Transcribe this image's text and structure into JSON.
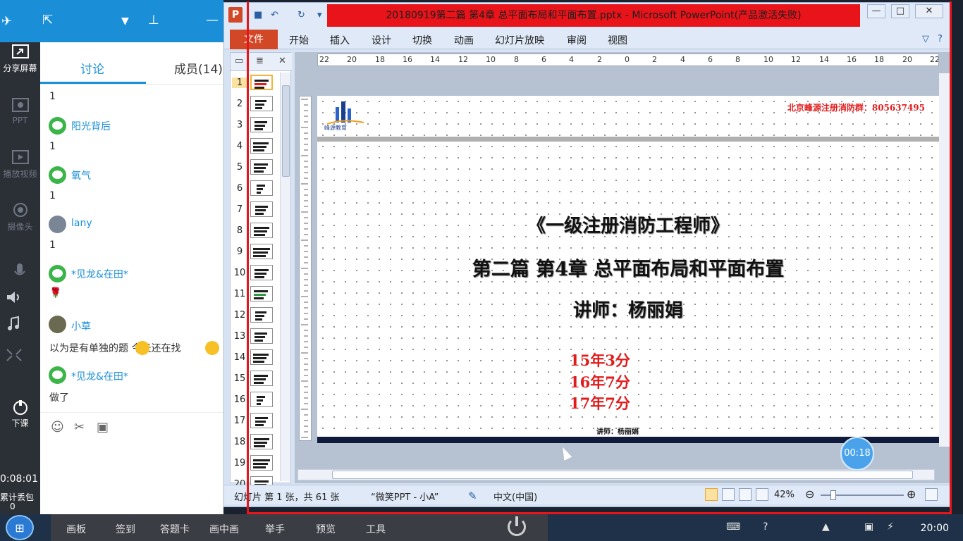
{
  "left_bar": {
    "items": [
      {
        "label": "分享屏幕",
        "icon": "share-screen-icon"
      },
      {
        "label": "PPT",
        "icon": "ppt-icon"
      },
      {
        "label": "播放视频",
        "icon": "play-video-icon"
      },
      {
        "label": "摄像头",
        "icon": "camera-icon"
      },
      {
        "label": "下课",
        "icon": "end-class-icon"
      }
    ],
    "session_time": "0:08:01",
    "loss_label": "累计丢包",
    "loss_count": "0"
  },
  "chat": {
    "tabs": {
      "discuss": "讨论",
      "members": "成员(14)"
    },
    "messages": [
      {
        "type": "text",
        "text": "1"
      },
      {
        "type": "name",
        "name": "阳光背后",
        "avatar": "wechat"
      },
      {
        "type": "text",
        "text": "1"
      },
      {
        "type": "name",
        "name": "氧气",
        "avatar": "wechat"
      },
      {
        "type": "text",
        "text": "1"
      },
      {
        "type": "name",
        "name": "lany",
        "avatar": "photo"
      },
      {
        "type": "text",
        "text": "1"
      },
      {
        "type": "name",
        "name": "*见龙&在田*",
        "avatar": "wechat"
      },
      {
        "type": "text",
        "text": "🌹"
      },
      {
        "type": "name",
        "name": "小草",
        "avatar": "photo"
      },
      {
        "type": "text",
        "text": "以为是有单独的题 今天还在找"
      },
      {
        "type": "name",
        "name": "*见龙&在田*",
        "avatar": "wechat"
      },
      {
        "type": "text",
        "text": "做了"
      }
    ]
  },
  "ppt": {
    "window_title": "20180919第二篇 第4章 总平面布局和平面布置.pptx - Microsoft PowerPoint(产品激活失败)",
    "ribbon_tabs": [
      "文件",
      "开始",
      "插入",
      "设计",
      "切换",
      "动画",
      "幻灯片放映",
      "审阅",
      "视图"
    ],
    "thumbnails": [
      "1",
      "2",
      "3",
      "4",
      "5",
      "6",
      "7",
      "8",
      "9",
      "10",
      "11",
      "12",
      "13",
      "14",
      "15",
      "16",
      "17",
      "18",
      "19",
      "20"
    ],
    "selected_slide": 1,
    "ruler_labels": [
      "22",
      "20",
      "18",
      "16",
      "14",
      "12",
      "10",
      "8",
      "6",
      "4",
      "2",
      "0",
      "2",
      "4",
      "6",
      "8",
      "10",
      "12",
      "14",
      "16",
      "18",
      "20",
      "22"
    ],
    "slide": {
      "logo_text": "峰源教育",
      "phone": "北京峰源注册消防群：805637495",
      "title1": "《一级注册消防工程师》",
      "title2": "第二篇 第4章 总平面布局和平面布置",
      "teacher": "讲师：杨丽娟",
      "scores": [
        "15年3分",
        "16年7分",
        "17年7分"
      ],
      "small_teacher": "讲师：杨丽娟"
    },
    "timer": "00:18",
    "status": {
      "slide_info": "幻灯片 第 1 张，共 61 张",
      "theme": "“微笑PPT - 小A”",
      "language": "中文(中国)",
      "zoom": "42%"
    }
  },
  "class_bar": [
    "画板",
    "签到",
    "答题卡",
    "画中画",
    "举手",
    "预览",
    "工具"
  ],
  "taskbar": {
    "clock": "20:00"
  },
  "colors": {
    "accent": "#1a8fd8",
    "ppt_orange": "#d24726",
    "recording_red": "#e8141a",
    "slide_red": "#e01c1c"
  }
}
